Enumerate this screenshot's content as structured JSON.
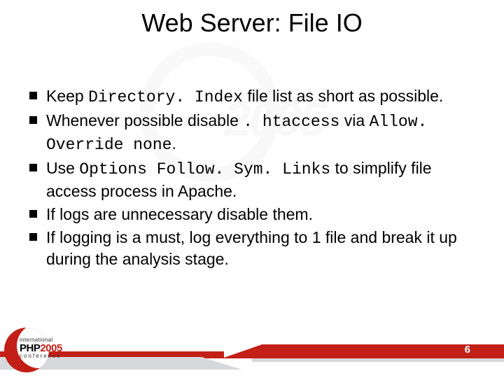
{
  "title": "Web Server: File IO",
  "bullets": [
    {
      "pre": "Keep ",
      "code1": "Directory. Index",
      "mid1": " file list as short as possible.",
      "code2": "",
      "mid2": "",
      "code3": "",
      "tail": ""
    },
    {
      "pre": "Whenever possible disable ",
      "code1": ". htaccess",
      "mid1": " via ",
      "code2": "Allow. Override none",
      "mid2": ".",
      "code3": "",
      "tail": ""
    },
    {
      "pre": "Use ",
      "code1": "Options Follow. Sym. Links",
      "mid1": " to simplify file access process in Apache.",
      "code2": "",
      "mid2": "",
      "code3": "",
      "tail": ""
    },
    {
      "pre": "If logs are unnecessary disable them.",
      "code1": "",
      "mid1": "",
      "code2": "",
      "mid2": "",
      "code3": "",
      "tail": ""
    },
    {
      "pre": "If logging is a must, log everything to 1 file and break it up during the analysis stage.",
      "code1": "",
      "mid1": "",
      "code2": "",
      "mid2": "",
      "code3": "",
      "tail": ""
    }
  ],
  "logo": {
    "line1": "international",
    "line2a": "PHP",
    "line2b": "2005",
    "line3": "conference"
  },
  "page_number": "6"
}
